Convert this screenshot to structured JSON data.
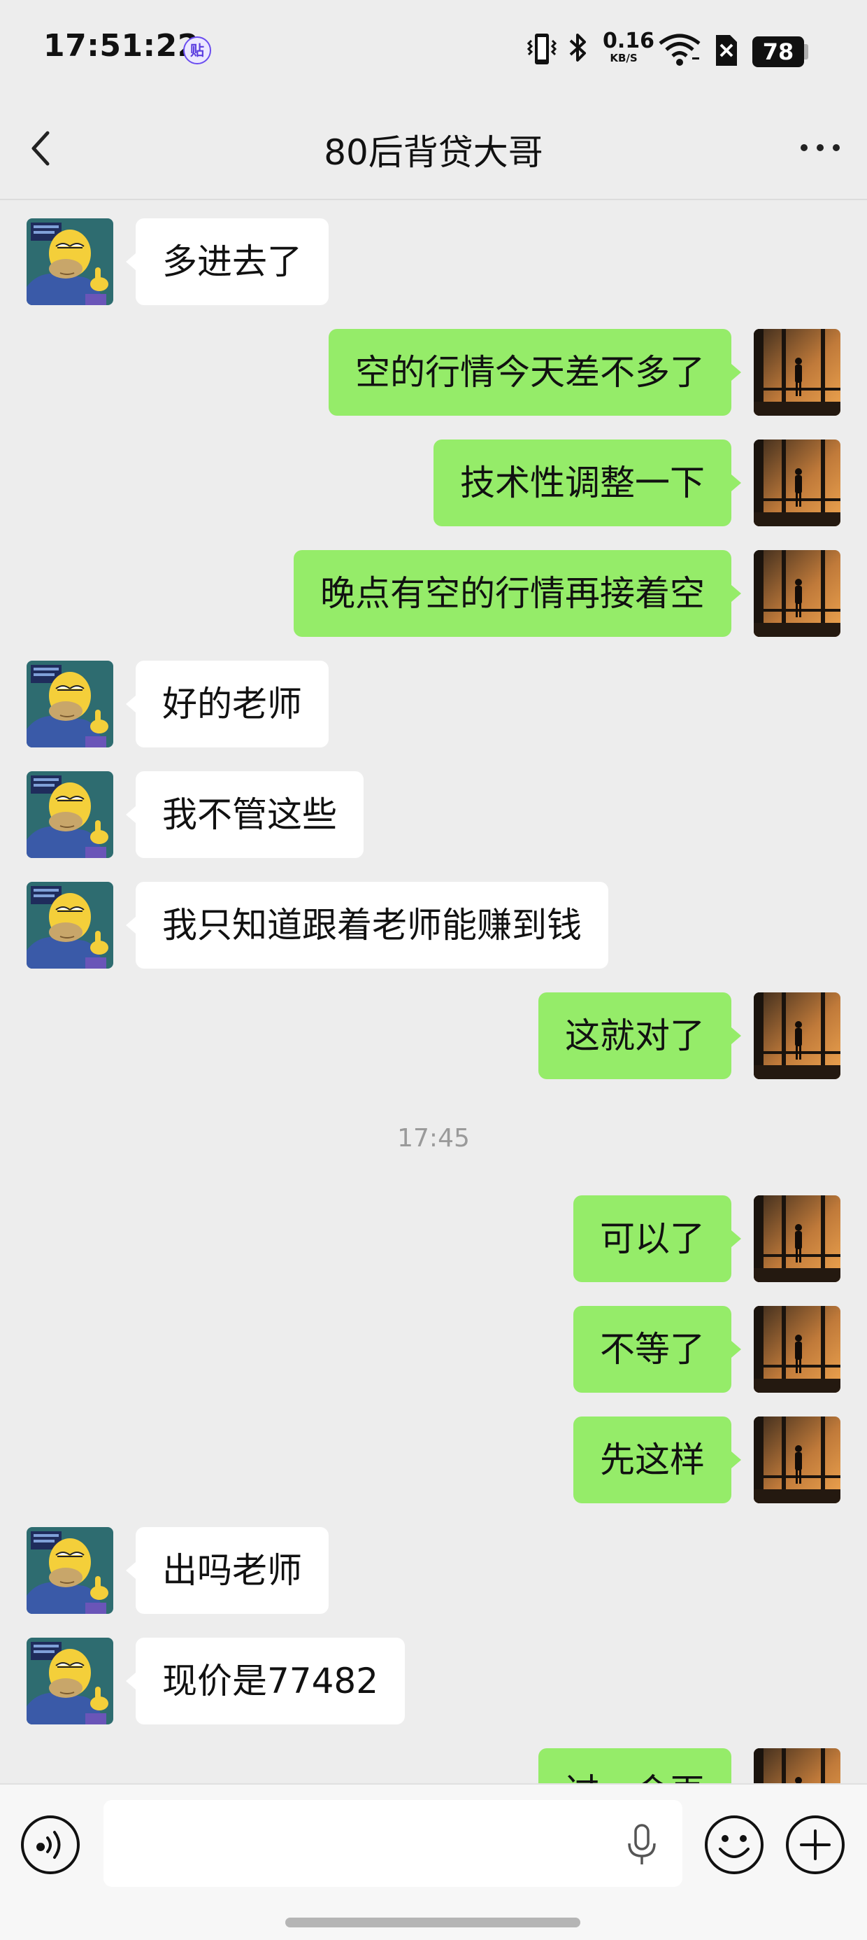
{
  "status_bar": {
    "time": "17:51:22",
    "badge_char": "贴",
    "net_speed_value": "0.16",
    "net_speed_unit": "KB/S",
    "battery": "78",
    "icons": [
      "vibrate-icon",
      "bluetooth-icon",
      "wifi-icon",
      "sim-off-icon",
      "battery-icon"
    ]
  },
  "header": {
    "title": "80后背贷大哥",
    "back_icon": "chevron-left-icon",
    "more_icon": "more-dots-icon"
  },
  "colors": {
    "page_bg": "#ededed",
    "outgoing_bubble": "#95ec69",
    "incoming_bubble": "#ffffff",
    "timestamp_text": "#9a9a9a"
  },
  "messages": [
    {
      "side": "in",
      "text": "多进去了"
    },
    {
      "side": "out",
      "text": "空的行情今天差不多了"
    },
    {
      "side": "out",
      "text": "技术性调整一下"
    },
    {
      "side": "out",
      "text": "晚点有空的行情再接着空"
    },
    {
      "side": "in",
      "text": "好的老师"
    },
    {
      "side": "in",
      "text": "我不管这些"
    },
    {
      "side": "in",
      "text": "我只知道跟着老师能赚到钱"
    },
    {
      "side": "out",
      "text": "这就对了"
    },
    {
      "side": "time",
      "text": "17:45"
    },
    {
      "side": "out",
      "text": "可以了"
    },
    {
      "side": "out",
      "text": "不等了"
    },
    {
      "side": "out",
      "text": "先这样"
    },
    {
      "side": "in",
      "text": "出吗老师"
    },
    {
      "side": "in",
      "text": "现价是77482"
    },
    {
      "side": "out",
      "text": "过一会再"
    }
  ],
  "input_bar": {
    "voice_icon": "voice-mode-icon",
    "mic_icon": "microphone-icon",
    "emoji_icon": "emoji-icon",
    "plus_icon": "plus-icon",
    "input_value": ""
  }
}
